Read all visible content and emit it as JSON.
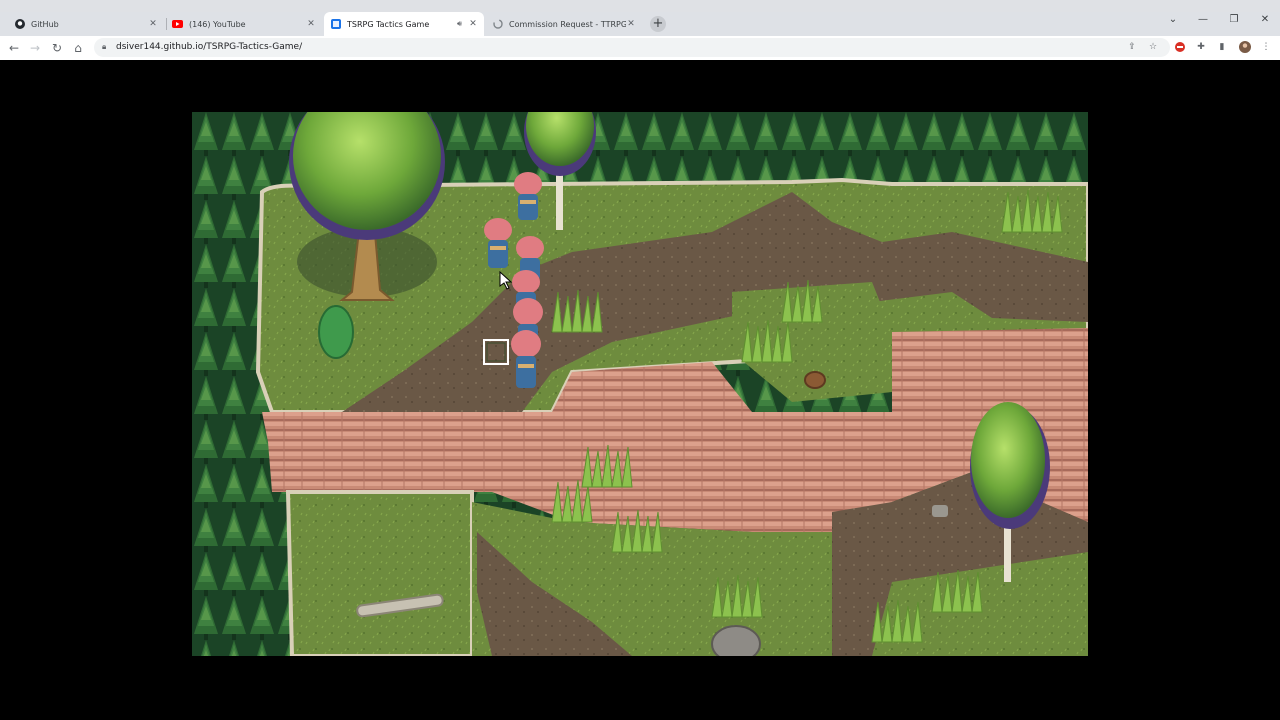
{
  "browser": {
    "tabs": [
      {
        "label": "GitHub",
        "icon": "github-icon"
      },
      {
        "label": "(146) YouTube",
        "icon": "youtube-icon"
      },
      {
        "label": "TSRPG Tactics Game",
        "icon": "site-icon",
        "active": true,
        "audio": "speaker-icon"
      },
      {
        "label": "Commission Request - TTRPG Ba",
        "icon": "loading-icon"
      }
    ],
    "url": "dsiver144.github.io/TSRPG-Tactics-Game/"
  },
  "game": {
    "scene": "forest cliff tactics map",
    "party_units": 6
  },
  "colors": {
    "forest": "#1f4d2b",
    "grass": "#6f8f3f",
    "dirt": "#6b5a45",
    "cliff": "#d79a86",
    "cursor": "#ffffff"
  }
}
